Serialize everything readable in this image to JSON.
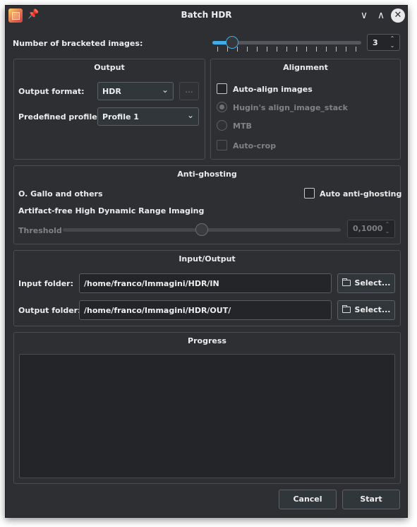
{
  "window": {
    "title": "Batch HDR",
    "controls": {
      "minimize": "∨",
      "maximize": "∧",
      "close": "✕"
    }
  },
  "bracketed": {
    "label": "Number of bracketed images:",
    "value": "3",
    "slider_fraction": 0.0
  },
  "output": {
    "title": "Output",
    "format_label": "Output format:",
    "format_value": "HDR",
    "dots": "...",
    "profile_label": "Predefined profile:",
    "profile_value": "Profile 1"
  },
  "alignment": {
    "title": "Alignment",
    "auto_align": "Auto-align images",
    "hugin": "Hugin's align_image_stack",
    "mtb": "MTB",
    "auto_crop": "Auto-crop"
  },
  "antighosting": {
    "title": "Anti-ghosting",
    "author": "O. Gallo and others",
    "method": "Artifact-free High Dynamic Range Imaging",
    "auto_label": "Auto anti-ghosting",
    "threshold_label": "Threshold",
    "threshold_value": "0,1000",
    "threshold_fraction": 0.5
  },
  "io": {
    "title": "Input/Output",
    "input_label": "Input folder:",
    "input_value": "/home/franco/Immagini/HDR/IN",
    "output_label": "Output folder:",
    "output_value": "/home/franco/Immagini/HDR/OUT/",
    "select_label": "Select..."
  },
  "progress": {
    "title": "Progress"
  },
  "buttons": {
    "cancel": "Cancel",
    "start": "Start"
  },
  "colors": {
    "accent": "#3daee9",
    "window_bg": "#2d2f33",
    "field_bg": "#232528"
  }
}
